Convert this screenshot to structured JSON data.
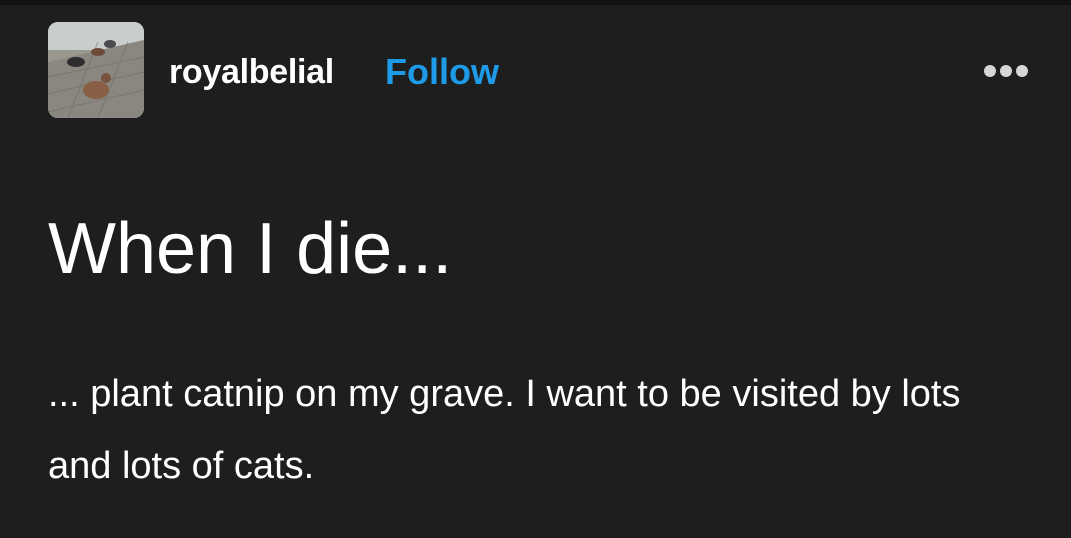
{
  "post": {
    "author": {
      "username": "royalbelial",
      "avatar_icon": "pigeons-photo-avatar"
    },
    "follow_label": "Follow",
    "more_icon": "more-options-icon",
    "title": "When I die...",
    "body": "... plant catnip on my grave. I want to be visited by lots and lots of cats."
  },
  "colors": {
    "background": "#1f1e1f",
    "text": "#ffffff",
    "follow_link": "#1e9be8",
    "more_icon": "#d6d6d6"
  }
}
